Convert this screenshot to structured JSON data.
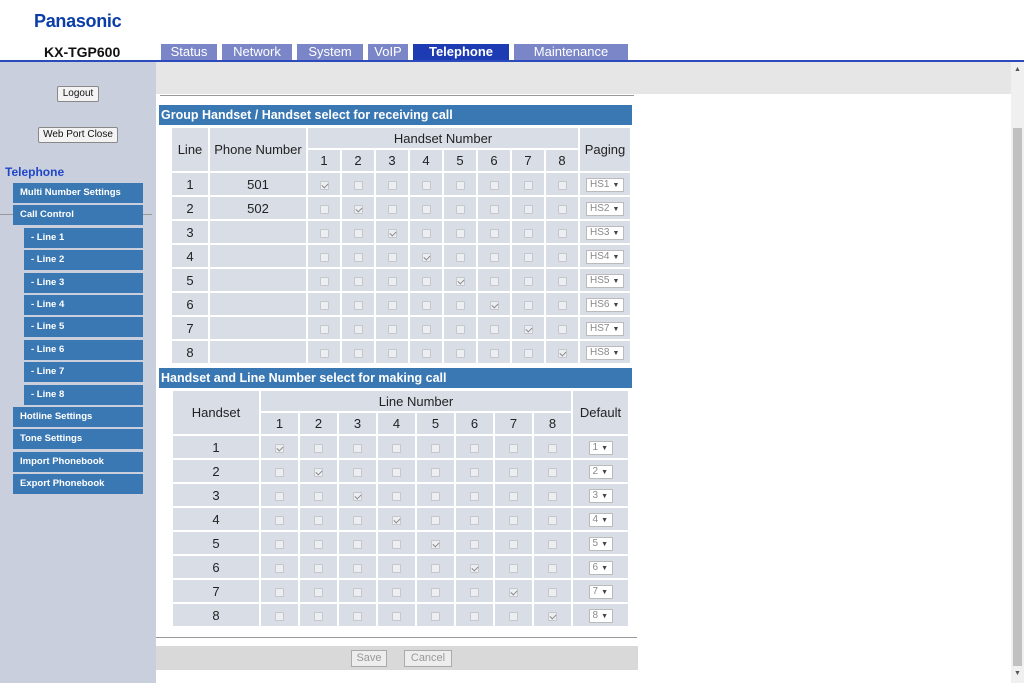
{
  "header": {
    "brand": "Panasonic",
    "model": "KX-TGP600"
  },
  "tabs": [
    "Status",
    "Network",
    "System",
    "VoIP",
    "Telephone",
    "Maintenance"
  ],
  "active_tab": "Telephone",
  "sidebar": {
    "logout": "Logout",
    "web_port_close": "Web Port Close",
    "category": "Telephone",
    "items": [
      {
        "label": "Multi Number Settings",
        "sub": false
      },
      {
        "label": "Call Control",
        "sub": false
      },
      {
        "label": "- Line 1",
        "sub": true
      },
      {
        "label": "- Line 2",
        "sub": true
      },
      {
        "label": "- Line 3",
        "sub": true
      },
      {
        "label": "- Line 4",
        "sub": true
      },
      {
        "label": "- Line 5",
        "sub": true
      },
      {
        "label": "- Line 6",
        "sub": true
      },
      {
        "label": "- Line 7",
        "sub": true
      },
      {
        "label": "- Line 8",
        "sub": true
      },
      {
        "label": "Hotline Settings",
        "sub": false
      },
      {
        "label": "Tone Settings",
        "sub": false
      },
      {
        "label": "Import Phonebook",
        "sub": false
      },
      {
        "label": "Export Phonebook",
        "sub": false
      }
    ]
  },
  "receive": {
    "title": "Group Handset / Handset select for receiving call",
    "col_line": "Line",
    "col_phone": "Phone Number",
    "col_handset_group": "Handset Number",
    "col_paging": "Paging",
    "handset_cols": [
      "1",
      "2",
      "3",
      "4",
      "5",
      "6",
      "7",
      "8"
    ],
    "rows": [
      {
        "line": "1",
        "phone": "501",
        "checked": [
          true,
          false,
          false,
          false,
          false,
          false,
          false,
          false
        ],
        "paging": "HS1"
      },
      {
        "line": "2",
        "phone": "502",
        "checked": [
          false,
          true,
          false,
          false,
          false,
          false,
          false,
          false
        ],
        "paging": "HS2"
      },
      {
        "line": "3",
        "phone": "",
        "checked": [
          false,
          false,
          true,
          false,
          false,
          false,
          false,
          false
        ],
        "paging": "HS3"
      },
      {
        "line": "4",
        "phone": "",
        "checked": [
          false,
          false,
          false,
          true,
          false,
          false,
          false,
          false
        ],
        "paging": "HS4"
      },
      {
        "line": "5",
        "phone": "",
        "checked": [
          false,
          false,
          false,
          false,
          true,
          false,
          false,
          false
        ],
        "paging": "HS5"
      },
      {
        "line": "6",
        "phone": "",
        "checked": [
          false,
          false,
          false,
          false,
          false,
          true,
          false,
          false
        ],
        "paging": "HS6"
      },
      {
        "line": "7",
        "phone": "",
        "checked": [
          false,
          false,
          false,
          false,
          false,
          false,
          true,
          false
        ],
        "paging": "HS7"
      },
      {
        "line": "8",
        "phone": "",
        "checked": [
          false,
          false,
          false,
          false,
          false,
          false,
          false,
          true
        ],
        "paging": "HS8"
      }
    ]
  },
  "make": {
    "title": "Handset and Line Number select for making call",
    "col_handset": "Handset",
    "col_line_group": "Line Number",
    "col_default": "Default",
    "line_cols": [
      "1",
      "2",
      "3",
      "4",
      "5",
      "6",
      "7",
      "8"
    ],
    "rows": [
      {
        "handset": "1",
        "checked": [
          true,
          false,
          false,
          false,
          false,
          false,
          false,
          false
        ],
        "default": "1"
      },
      {
        "handset": "2",
        "checked": [
          false,
          true,
          false,
          false,
          false,
          false,
          false,
          false
        ],
        "default": "2"
      },
      {
        "handset": "3",
        "checked": [
          false,
          false,
          true,
          false,
          false,
          false,
          false,
          false
        ],
        "default": "3"
      },
      {
        "handset": "4",
        "checked": [
          false,
          false,
          false,
          true,
          false,
          false,
          false,
          false
        ],
        "default": "4"
      },
      {
        "handset": "5",
        "checked": [
          false,
          false,
          false,
          false,
          true,
          false,
          false,
          false
        ],
        "default": "5"
      },
      {
        "handset": "6",
        "checked": [
          false,
          false,
          false,
          false,
          false,
          true,
          false,
          false
        ],
        "default": "6"
      },
      {
        "handset": "7",
        "checked": [
          false,
          false,
          false,
          false,
          false,
          false,
          true,
          false
        ],
        "default": "7"
      },
      {
        "handset": "8",
        "checked": [
          false,
          false,
          false,
          false,
          false,
          false,
          false,
          true
        ],
        "default": "8"
      }
    ]
  },
  "footer": {
    "save": "Save",
    "cancel": "Cancel"
  },
  "icons": {
    "dropdown": "dropdown-arrow-icon",
    "scroll_up": "scroll-up-icon",
    "scroll_down": "scroll-down-icon"
  }
}
